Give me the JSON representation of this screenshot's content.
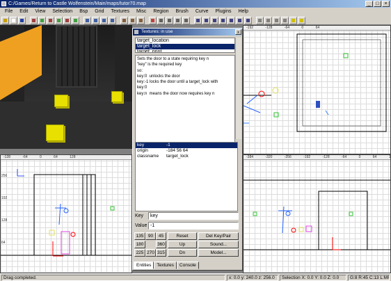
{
  "window": {
    "title": "C:/Games/Return to Castle Wolfenstein/Main/maps/tutor70.map"
  },
  "menu": [
    "File",
    "Edit",
    "View",
    "Selection",
    "Bsp",
    "Grid",
    "Textures",
    "Misc",
    "Region",
    "Brush",
    "Curve",
    "Plugins",
    "Help"
  ],
  "panel": {
    "title": "Textures: in use",
    "close_label": "x",
    "classlist": [
      "target_location",
      "target_lock",
      "target_print"
    ],
    "selected_class": "target_lock",
    "description": "Sets the door to a state requiring key n\n\"key\" is the required key\nso:\nkey:0  unlocks the door\nkey:-1 locks the door until a target_lock with\nkey:0\nkey:n  means the door now requires key n",
    "kv": [
      {
        "key": "key",
        "value": "-1",
        "selected": true
      },
      {
        "key": "origin",
        "value": "-184 56 64",
        "selected": false
      },
      {
        "key": "classname",
        "value": "target_lock",
        "selected": false
      }
    ],
    "key_label": "Key",
    "key_value": "key",
    "value_label": "Value",
    "value_value": "-1",
    "angle_buttons": [
      "135",
      "90",
      "45",
      "180",
      "360",
      "225",
      "270",
      "315"
    ],
    "reset_label": "Reset",
    "up_label": "Up",
    "dn_label": "Dn",
    "del_label": "Del Key/Pair",
    "sound_label": "Sound...",
    "model_label": "Model...",
    "tabs": [
      "Entities",
      "Textures",
      "Console"
    ]
  },
  "views": {
    "top_right_ruler": "-192   -128   -64   0   64",
    "bottom_left_ruler": "-128   -64   0   64   128",
    "bottom_right_ruler": "-384   -320   -256   -192   -128   -64   0   64   128",
    "left_ticks": [
      "256",
      "192",
      "128",
      "64"
    ]
  },
  "status": {
    "message": "Drag completed.",
    "coords": "x: 0.0  y: 240.0  z: 256.0",
    "selection": "Selection X: 0.0  Y: 0.0  Z: 0.0",
    "grid": "G:8 R:45 C:13 L:MR"
  }
}
